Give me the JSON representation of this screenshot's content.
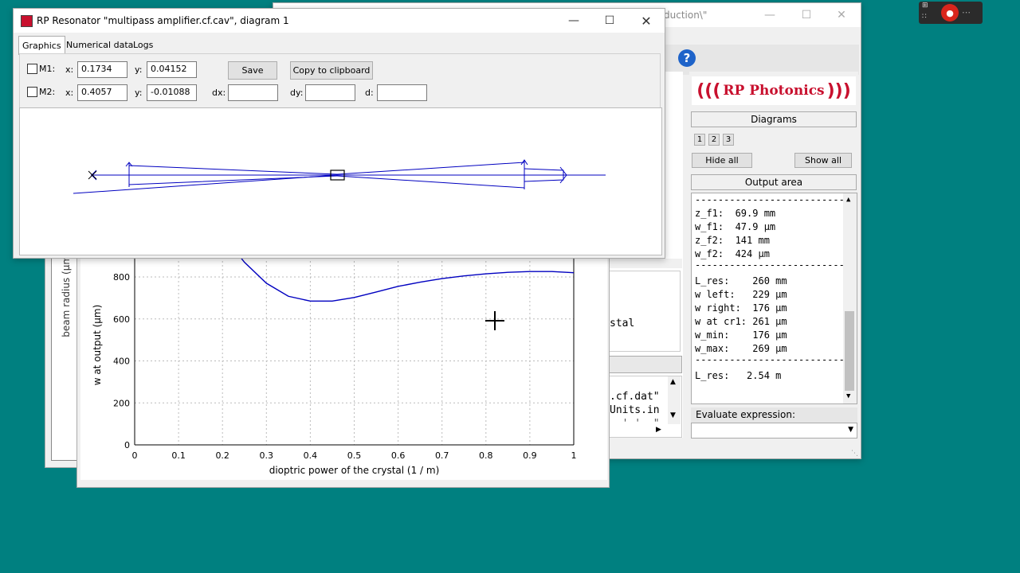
{
  "back_window": {
    "title_tail": "duction\\\"",
    "output_tail": "stal",
    "script_lines": [
      ".cf.dat\"",
      "Units.in",
      "  ' '  \""
    ]
  },
  "logo": {
    "text": "RP Photonics"
  },
  "right_panel": {
    "diagrams_label": "Diagrams",
    "diagram_buttons": [
      "1",
      "2",
      "3"
    ],
    "hide_all": "Hide all",
    "show_all": "Show all",
    "output_label": "Output area",
    "output_lines": [
      "------------------------------",
      "z_f1:  69.9 mm",
      "w_f1:  47.9 µm",
      "z_f2:  141 mm",
      "w_f2:  424 µm",
      "------------------------------",
      "L_res:    260 mm",
      "w left:   229 µm",
      "w right:  176 µm",
      "w at cr1: 261 µm",
      "w_min:    176 µm",
      "w_max:    269 µm",
      "------------------------------",
      "L_res:   2.54 m"
    ],
    "evaluate_label": "Evaluate expression:",
    "evaluate_value": ""
  },
  "diagram_window": {
    "title": "RP Resonator \"multipass amplifier.cf.cav\", diagram 1",
    "tabs": [
      "Graphics",
      "Numerical data",
      "Logs"
    ],
    "active_tab": "Graphics",
    "m1": {
      "label": "M1:",
      "x_label": "x:",
      "x": "0.1734",
      "y_label": "y:",
      "y": "0.04152"
    },
    "m2": {
      "label": "M2:",
      "x_label": "x:",
      "x": "0.4057",
      "y_label": "y:",
      "y": "-0.01088"
    },
    "dx_label": "dx:",
    "dx": "",
    "dy_label": "dy:",
    "dy": "",
    "d_label": "d:",
    "d": "",
    "save": "Save",
    "copy": "Copy to clipboard"
  },
  "plot_window": {
    "outer_ylabel": "beam radius (µm)"
  },
  "chart_data": {
    "type": "line",
    "xlabel": "dioptric power of the crystal (1 / m)",
    "ylabel": "w at output (µm)",
    "xlim": [
      0,
      1
    ],
    "ylim": [
      0,
      1000
    ],
    "xticks": [
      "0",
      "0.1",
      "0.2",
      "0.3",
      "0.4",
      "0.5",
      "0.6",
      "0.7",
      "0.8",
      "0.9",
      "1"
    ],
    "yticks": [
      "0",
      "200",
      "400",
      "600",
      "800"
    ],
    "grid": true,
    "series": [
      {
        "color": "#0000c0",
        "x": [
          0.2,
          0.22,
          0.25,
          0.3,
          0.35,
          0.4,
          0.45,
          0.5,
          0.55,
          0.6,
          0.65,
          0.7,
          0.75,
          0.8,
          0.85,
          0.9,
          0.95,
          1.0
        ],
        "y": [
          1050,
          950,
          870,
          770,
          708,
          685,
          685,
          702,
          728,
          755,
          775,
          792,
          805,
          815,
          822,
          826,
          826,
          820
        ]
      }
    ]
  }
}
